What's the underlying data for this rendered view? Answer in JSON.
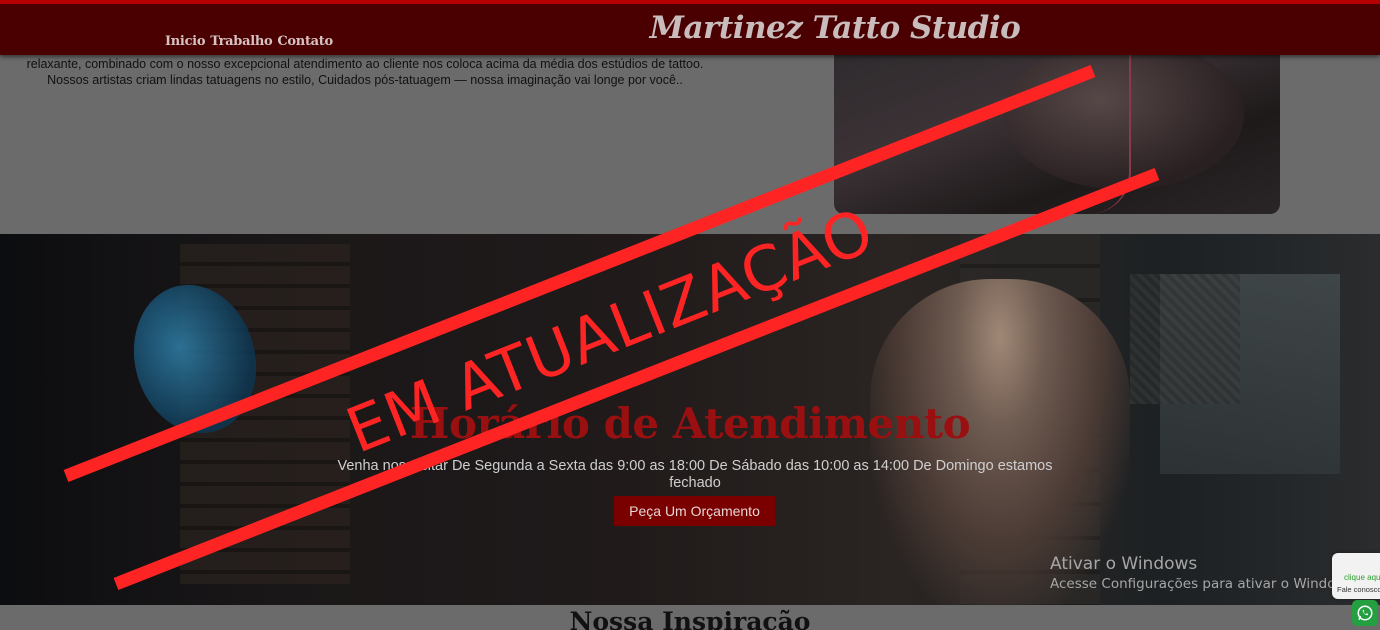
{
  "header": {
    "brand": "Martinez Tatto Studio",
    "nav": [
      "Inicio",
      "Trabalho",
      "Contato"
    ]
  },
  "about": {
    "text": "relaxante, combinado com o nosso excepcional atendimento ao cliente nos coloca acima da média dos estúdios de tattoo. Nossos artistas criam lindas tatuagens no estilo, Cuidados pós-tatuagem — nossa imaginação vai longe por você.."
  },
  "hero": {
    "title": "Horário de Atendimento",
    "text": "Venha nos visitar De Segunda a Sexta das 9:00 as 18:00 De Sábado das 10:00 as 14:00 De Domingo estamos fechado",
    "button": "Peça Um Orçamento"
  },
  "inspiration": {
    "title": "Nossa Inspiração"
  },
  "overlay": {
    "stamp": "EM ATUALIZAÇÃO",
    "color": "#ff2424"
  },
  "windows_activation": {
    "title": "Ativar o Windows",
    "subtitle": "Acesse Configurações para ativar o Windows."
  },
  "whatsapp": {
    "line1": "clique aqui",
    "line2": "Fale conosco",
    "icon": "whatsapp-icon"
  }
}
